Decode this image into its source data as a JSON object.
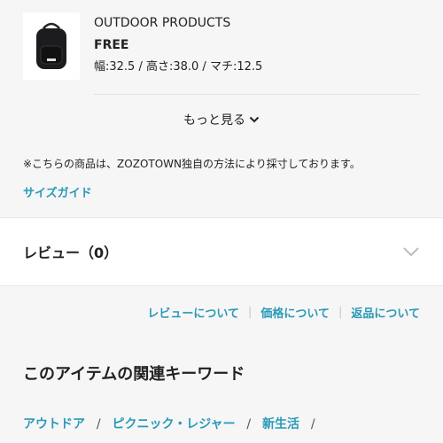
{
  "size_table": {
    "brand": "OUTDOOR PRODUCTS",
    "size": "FREE",
    "dimensions": "幅:32.5 / 高さ:38.0 / マチ:12.5",
    "more_label": "もっと見る",
    "note": "※こちらの商品は、ZOZOTOWN独自の方法により採寸しております。",
    "size_guide_label": "サイズガイド"
  },
  "review": {
    "title": "レビュー（0）"
  },
  "info_links": [
    "レビューについて",
    "価格について",
    "返品について"
  ],
  "keywords": {
    "title": "このアイテムの関連キーワード",
    "items": [
      "アウトドア",
      "ピクニック・レジャー",
      "新生活"
    ]
  },
  "colors": {
    "accent": "#2a9ab8",
    "background": "#f6f6f6"
  }
}
